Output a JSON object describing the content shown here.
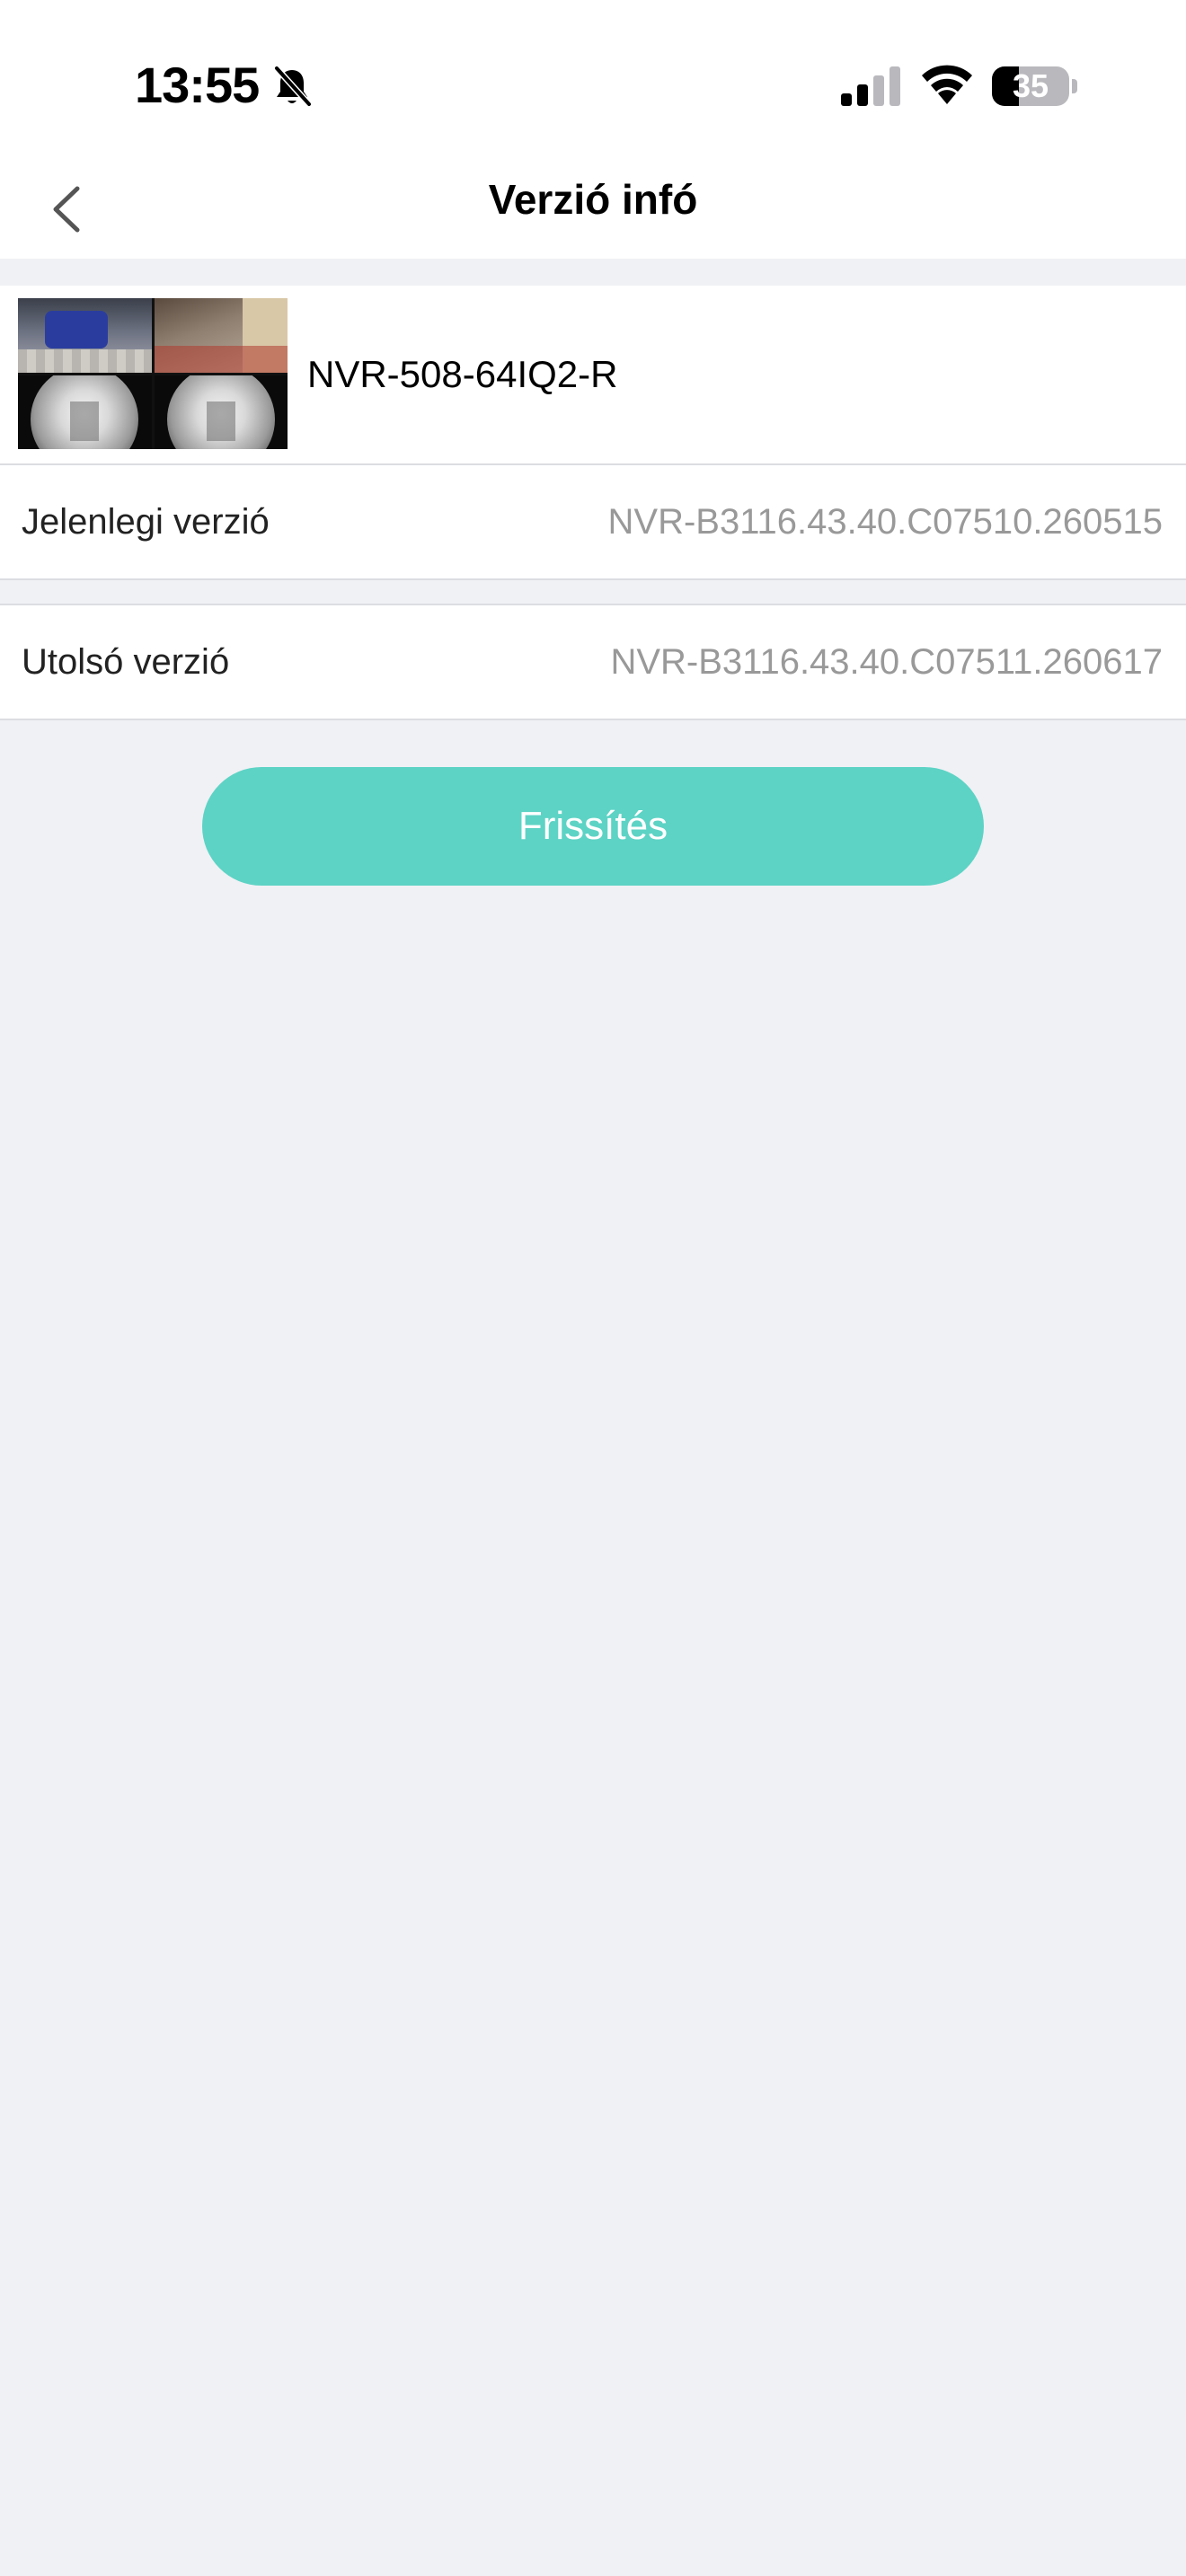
{
  "status_bar": {
    "time": "13:55",
    "battery_percent": "35",
    "battery_level": 0.35,
    "icons": [
      "bell-slash-icon",
      "cellular-signal-icon",
      "wifi-icon",
      "battery-icon"
    ]
  },
  "nav": {
    "back_icon": "chevron-left-icon",
    "title": "Verzió infó"
  },
  "device": {
    "thumbnail_icon": "camera-grid-thumbnail",
    "name": "NVR-508-64IQ2-R"
  },
  "versions": {
    "current": {
      "label": "Jelenlegi verzió",
      "value": "NVR-B3116.43.40.C07510.260515"
    },
    "latest": {
      "label": "Utolsó verzió",
      "value": "NVR-B3116.43.40.C07511.260617"
    }
  },
  "actions": {
    "update_label": "Frissítés"
  },
  "colors": {
    "accent": "#5dd3c5",
    "page_background": "#f0f1f5",
    "value_text": "#999999"
  }
}
